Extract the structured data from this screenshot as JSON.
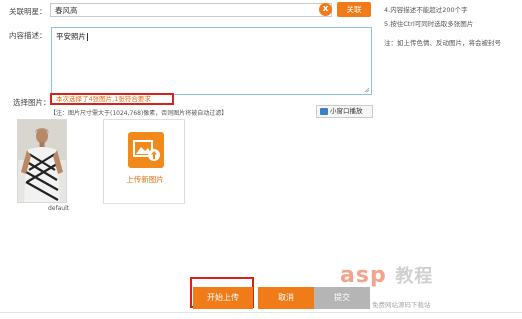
{
  "form": {
    "star_label": "关联明星：",
    "star_value": "春风高",
    "clear_glyph": "x",
    "link_button": "关联",
    "desc_label": "内容描述：",
    "desc_value": "平安照片",
    "select_label": "选择图片：",
    "select_status": "本次选择了4张图片,1张符合要求",
    "size_note": "【注：图片尺寸需大于(1024,768)像素，否则图片将被自动过滤】",
    "mini_window": "小窗口播放"
  },
  "tips": {
    "line1": "4.内容描述不能超过200个字",
    "line2": "5.按住Ctrl可同时选取多张图片",
    "line3": "注：如上传色情、反动图片，将会被封号"
  },
  "gallery": {
    "photo_caption": "default",
    "upload_label": "上传新图片"
  },
  "actions": {
    "start_upload": "开始上传",
    "cancel": "取消",
    "submit": "提交"
  },
  "watermark": {
    "text": "asp 教程 免费网站源码下载站"
  },
  "colors": {
    "accent": "#f07c19",
    "highlight_red": "#d6221a",
    "disabled_gray": "#b5b5b5"
  }
}
